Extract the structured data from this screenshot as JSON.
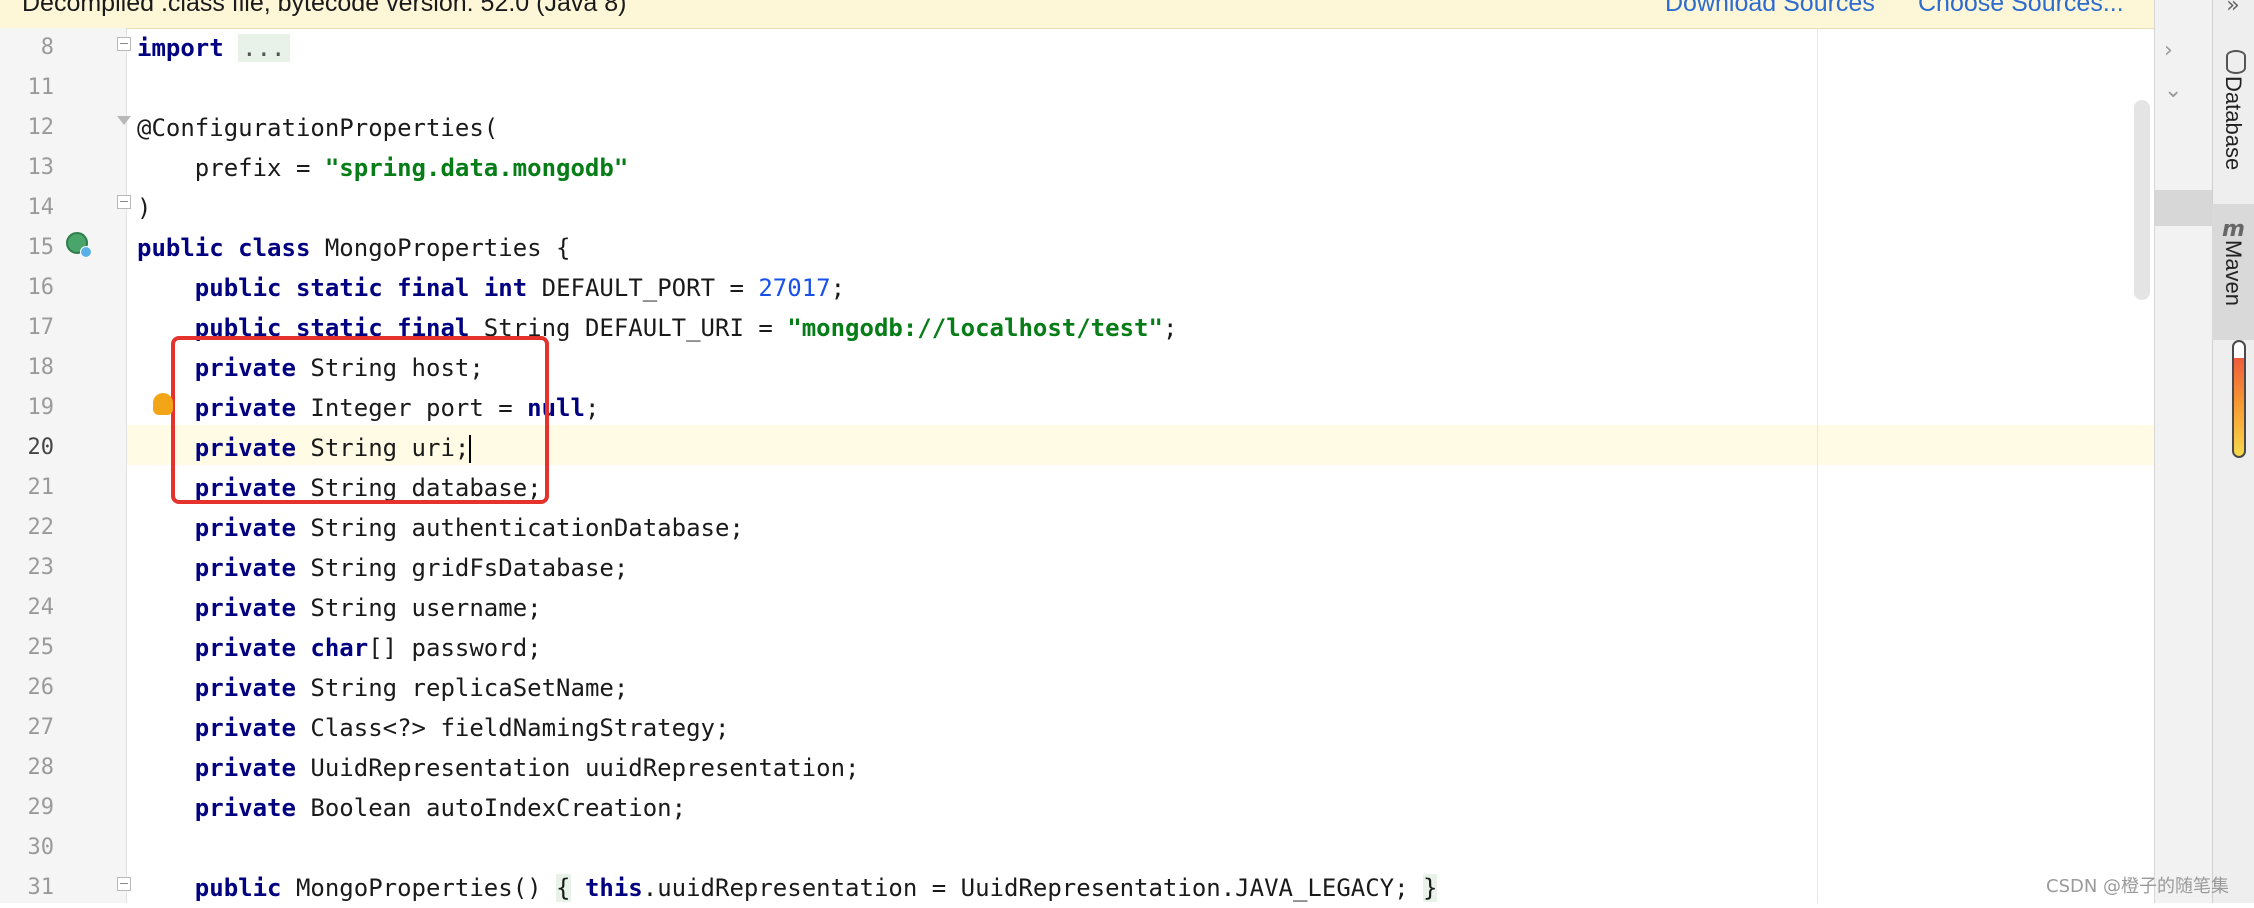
{
  "banner": {
    "message": "Decompiled .class file, bytecode version: 52.0 (Java 8)",
    "download_sources": "Download Sources",
    "choose_sources": "Choose Sources..."
  },
  "gutter": {
    "line_numbers": [
      "8",
      "11",
      "12",
      "13",
      "14",
      "15",
      "16",
      "17",
      "18",
      "19",
      "20",
      "21",
      "22",
      "23",
      "24",
      "25",
      "26",
      "27",
      "28",
      "29",
      "30",
      "31"
    ],
    "current_line": "20"
  },
  "code_lines": [
    {
      "ln": "8",
      "text": "import ..."
    },
    {
      "ln": "11",
      "text": ""
    },
    {
      "ln": "12",
      "text": "@ConfigurationProperties("
    },
    {
      "ln": "13",
      "text": "    prefix = \"spring.data.mongodb\""
    },
    {
      "ln": "14",
      "text": ")"
    },
    {
      "ln": "15",
      "text": "public class MongoProperties {"
    },
    {
      "ln": "16",
      "text": "    public static final int DEFAULT_PORT = 27017;"
    },
    {
      "ln": "17",
      "text": "    public static final String DEFAULT_URI = \"mongodb://localhost/test\";"
    },
    {
      "ln": "18",
      "text": "    private String host;"
    },
    {
      "ln": "19",
      "text": "    private Integer port = null;"
    },
    {
      "ln": "20",
      "text": "    private String uri;"
    },
    {
      "ln": "21",
      "text": "    private String database;"
    },
    {
      "ln": "22",
      "text": "    private String authenticationDatabase;"
    },
    {
      "ln": "23",
      "text": "    private String gridFsDatabase;"
    },
    {
      "ln": "24",
      "text": "    private String username;"
    },
    {
      "ln": "25",
      "text": "    private char[] password;"
    },
    {
      "ln": "26",
      "text": "    private String replicaSetName;"
    },
    {
      "ln": "27",
      "text": "    private Class<?> fieldNamingStrategy;"
    },
    {
      "ln": "28",
      "text": "    private UuidRepresentation uuidRepresentation;"
    },
    {
      "ln": "29",
      "text": "    private Boolean autoIndexCreation;"
    },
    {
      "ln": "30",
      "text": ""
    },
    {
      "ln": "31",
      "text": "    public MongoProperties() { this.uuidRepresentation = UuidRepresentation.JAVA_LEGACY; }"
    }
  ],
  "tokens": {
    "import": "import",
    "fold_dots": "...",
    "annotation": "@ConfigurationProperties(",
    "prefix_key": "prefix = ",
    "prefix_val": "\"spring.data.mongodb\"",
    "close_paren": ")",
    "public": "public",
    "class": "class",
    "static": "static",
    "final": "final",
    "int": "int",
    "private": "private",
    "char": "char",
    "this": "this",
    "null": "null",
    "class_name": "MongoProperties {",
    "default_port": " DEFAULT_PORT = ",
    "port_value": "27017",
    "default_uri_decl": " String DEFAULT_URI = ",
    "default_uri_val": "\"mongodb://localhost/test\"",
    "semicolon": ";",
    "f_host": " String host;",
    "f_port": " Integer port = ",
    "f_uri": " String uri;",
    "f_database": " String database;",
    "f_authdb": " String authenticationDatabase;",
    "f_gridfs": " String gridFsDatabase;",
    "f_username": " String username;",
    "f_password_a": "[] password;",
    "f_replica": " String replicaSetName;",
    "f_naming": " Class<?> fieldNamingStrategy;",
    "f_uuid": " UuidRepresentation uuidRepresentation;",
    "f_autoindex": " Boolean autoIndexCreation;",
    "ctor_a": " MongoProperties() ",
    "brace_open": "{",
    "ctor_b": ".uuidRepresentation = UuidRepresentation.JAVA_LEGACY;",
    "brace_close": "}"
  },
  "right_bar": {
    "database_tab": "Database",
    "maven_tab": "Maven",
    "maven_icon": "m",
    "collapse_glyph": "»"
  },
  "colors": {
    "keyword": "#000080",
    "string": "#067d17",
    "number": "#1750eb",
    "highlight_box": "#e6322c",
    "banner_bg": "#fdf7d8",
    "link": "#2d6bcf"
  },
  "watermark": "CSDN @橙子的随笔集"
}
